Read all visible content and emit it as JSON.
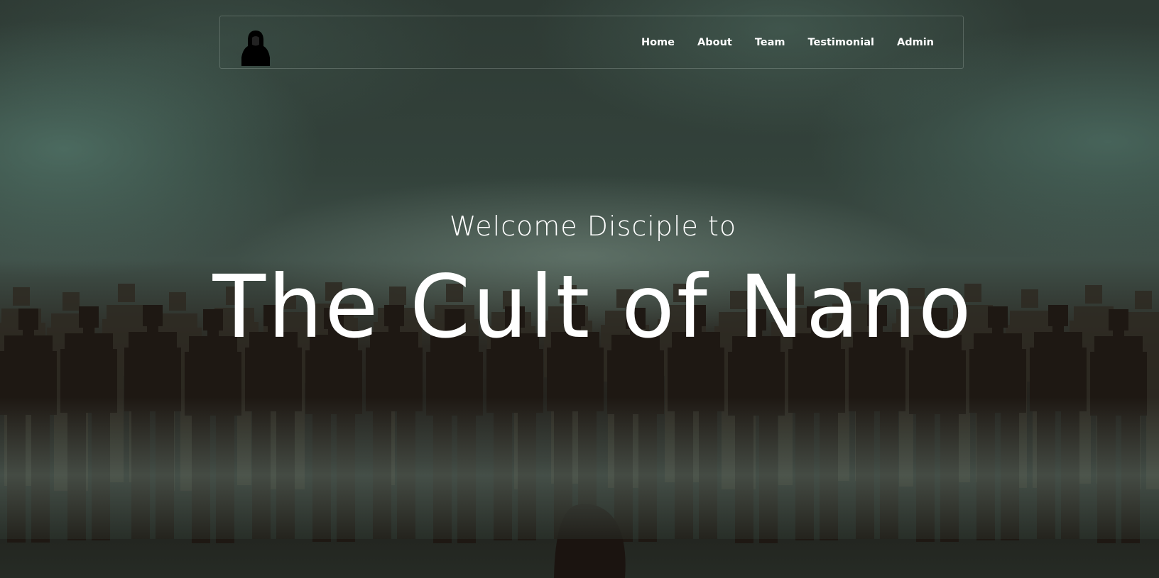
{
  "logo": {
    "icon": "hooded-figure-icon"
  },
  "nav": {
    "items": [
      {
        "label": "Home"
      },
      {
        "label": "About"
      },
      {
        "label": "Team"
      },
      {
        "label": "Testimonial"
      },
      {
        "label": "Admin"
      }
    ]
  },
  "hero": {
    "subtitle": "Welcome Disciple to",
    "title": "The Cult of Nano"
  },
  "colors": {
    "text": "#ffffff",
    "mist": "#5f8a7e",
    "silhouette": "#1e1813"
  }
}
